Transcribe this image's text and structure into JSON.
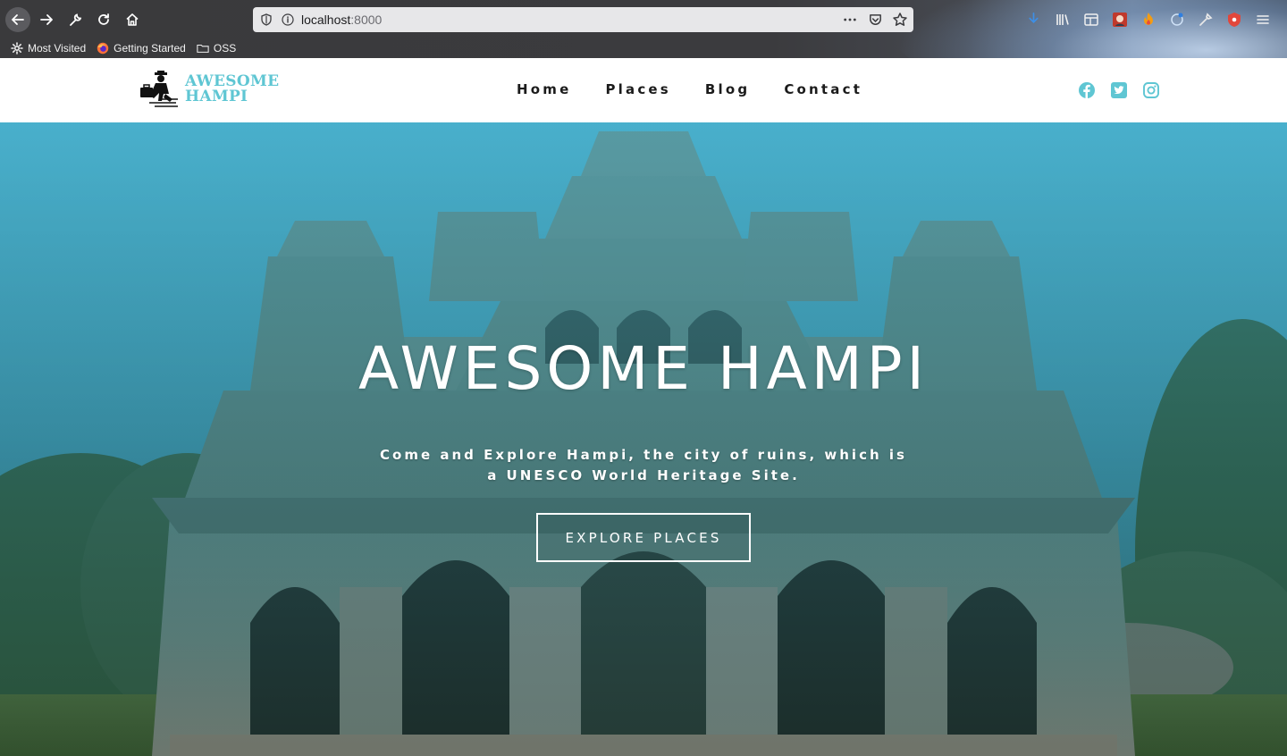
{
  "browser": {
    "url_host": "localhost",
    "url_port": ":8000",
    "bookmarks": [
      {
        "label": "Most Visited",
        "icon": "gear-icon"
      },
      {
        "label": "Getting Started",
        "icon": "firefox-icon"
      },
      {
        "label": "OSS",
        "icon": "folder-icon"
      }
    ],
    "extension_icons": [
      "download-icon",
      "library-icon",
      "reader-icon",
      "ext-red-icon",
      "fire-icon",
      "ext-bug-icon",
      "eyedropper-icon",
      "shield-red-icon",
      "menu-icon"
    ]
  },
  "site": {
    "logo_line1": "AWESOME",
    "logo_line2": "HAMPI",
    "nav": [
      "Home",
      "Places",
      "Blog",
      "Contact"
    ],
    "social": [
      "facebook-icon",
      "twitter-icon",
      "instagram-icon"
    ],
    "accent_color": "#5fc6d3"
  },
  "hero": {
    "title": "AWESOME HAMPI",
    "subtitle": "Come and Explore Hampi, the city of ruins, which is a UNESCO World Heritage Site.",
    "button": "EXPLORE PLACES"
  }
}
